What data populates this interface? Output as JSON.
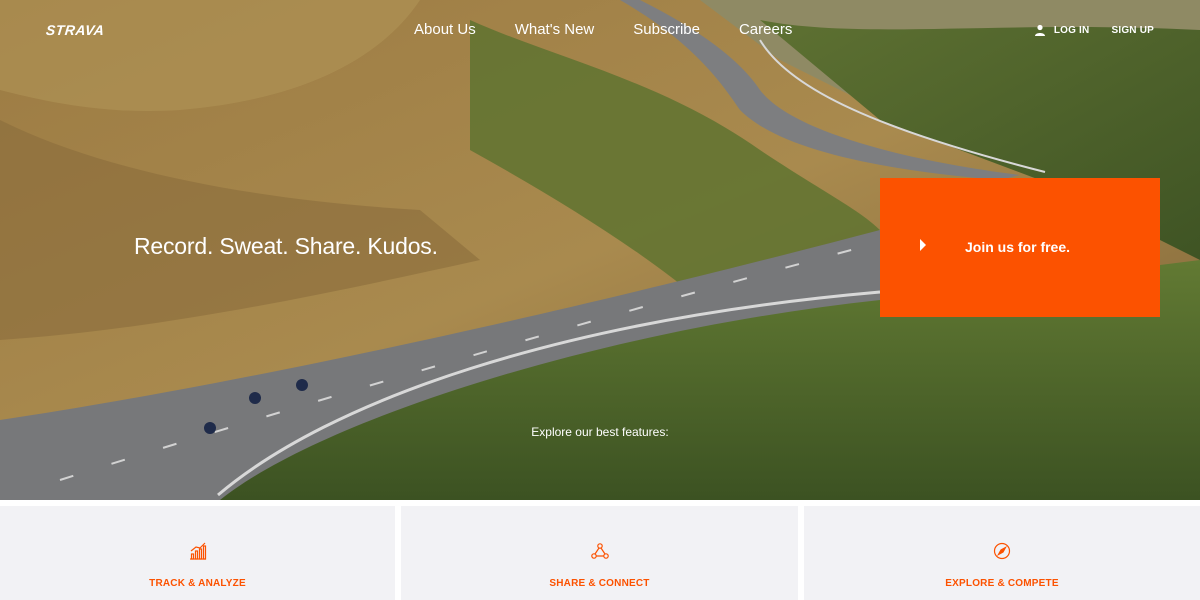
{
  "brand": {
    "logo_text": "STRAVA",
    "accent": "#fc5200"
  },
  "nav": {
    "links": [
      "About Us",
      "What's New",
      "Subscribe",
      "Careers"
    ],
    "login_label": "LOG IN",
    "signup_label": "SIGN UP",
    "login_icon": "user-icon"
  },
  "hero": {
    "tagline": "Record. Sweat. Share. Kudos.",
    "cta_label": "Join us for free.",
    "cta_icon": "play-arrow-icon",
    "explore_text": "Explore our best features:"
  },
  "features": [
    {
      "label": "TRACK & ANALYZE",
      "icon": "bar-chart-icon"
    },
    {
      "label": "SHARE & CONNECT",
      "icon": "network-icon"
    },
    {
      "label": "EXPLORE & COMPETE",
      "icon": "compass-icon"
    }
  ]
}
